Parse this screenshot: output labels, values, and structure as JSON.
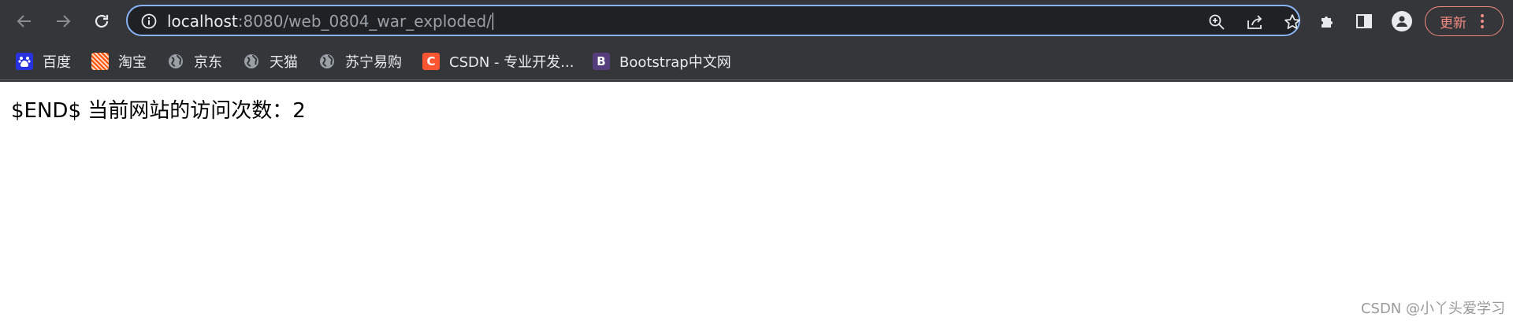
{
  "toolbar": {
    "url_host": "localhost",
    "url_path": ":8080/web_0804_war_exploded/",
    "update_label": "更新"
  },
  "bookmarks": [
    {
      "label": "百度",
      "icon": "baidu-icon",
      "color": "#2932e1"
    },
    {
      "label": "淘宝",
      "icon": "taobao-icon",
      "color": "#ff5000"
    },
    {
      "label": "京东",
      "icon": "globe-icon",
      "color": "#9aa0a6"
    },
    {
      "label": "天猫",
      "icon": "globe-icon",
      "color": "#9aa0a6"
    },
    {
      "label": "苏宁易购",
      "icon": "globe-icon",
      "color": "#9aa0a6"
    },
    {
      "label": "CSDN - 专业开发...",
      "icon": "csdn-icon",
      "color": "#fc5531",
      "glyph": "C"
    },
    {
      "label": "Bootstrap中文网",
      "icon": "bootstrap-icon",
      "color": "#563d7c",
      "glyph": "B"
    }
  ],
  "page": {
    "body_text": "$END$ 当前网站的访问次数：2"
  },
  "watermark": "CSDN @小丫头爱学习",
  "colors": {
    "chrome_bg": "#35363a",
    "omnibox_bg": "#202124",
    "focus_ring": "#8ab4f8",
    "update_accent": "#f28b82"
  }
}
